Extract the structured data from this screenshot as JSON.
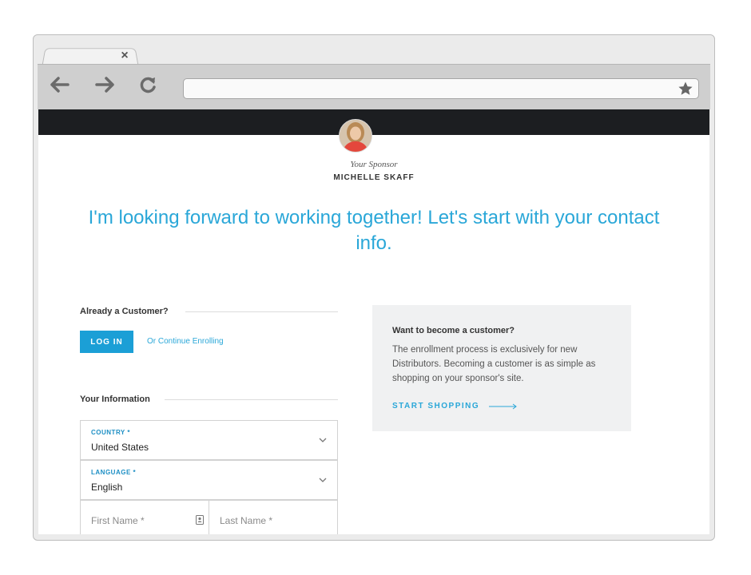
{
  "browser": {
    "tab_close": "×",
    "icons": [
      "back-arrow-icon",
      "forward-arrow-icon",
      "refresh-icon",
      "star-icon",
      "close-icon"
    ]
  },
  "sponsor": {
    "label": "Your Sponsor",
    "name": "MICHELLE SKAFF"
  },
  "headline": "I'm looking forward to working together! Let's start with your contact info.",
  "customer": {
    "title": "Already a Customer?",
    "login_label": "LOG IN",
    "continue_label": "Or Continue Enrolling"
  },
  "your_info": {
    "title": "Your Information",
    "country": {
      "label": "COUNTRY *",
      "value": "United States"
    },
    "language": {
      "label": "LANGUAGE *",
      "value": "English"
    },
    "first_name_placeholder": "First Name *",
    "last_name_placeholder": "Last Name *"
  },
  "info_box": {
    "title": "Want to become a customer?",
    "body": "The enrollment process is exclusively for new Distributors. Becoming a customer is as simple as shopping on your sponsor's site.",
    "link": "START SHOPPING"
  },
  "colors": {
    "accent": "#2aa7d8",
    "button": "#1b9fd6",
    "topbar": "#1c1e21"
  }
}
